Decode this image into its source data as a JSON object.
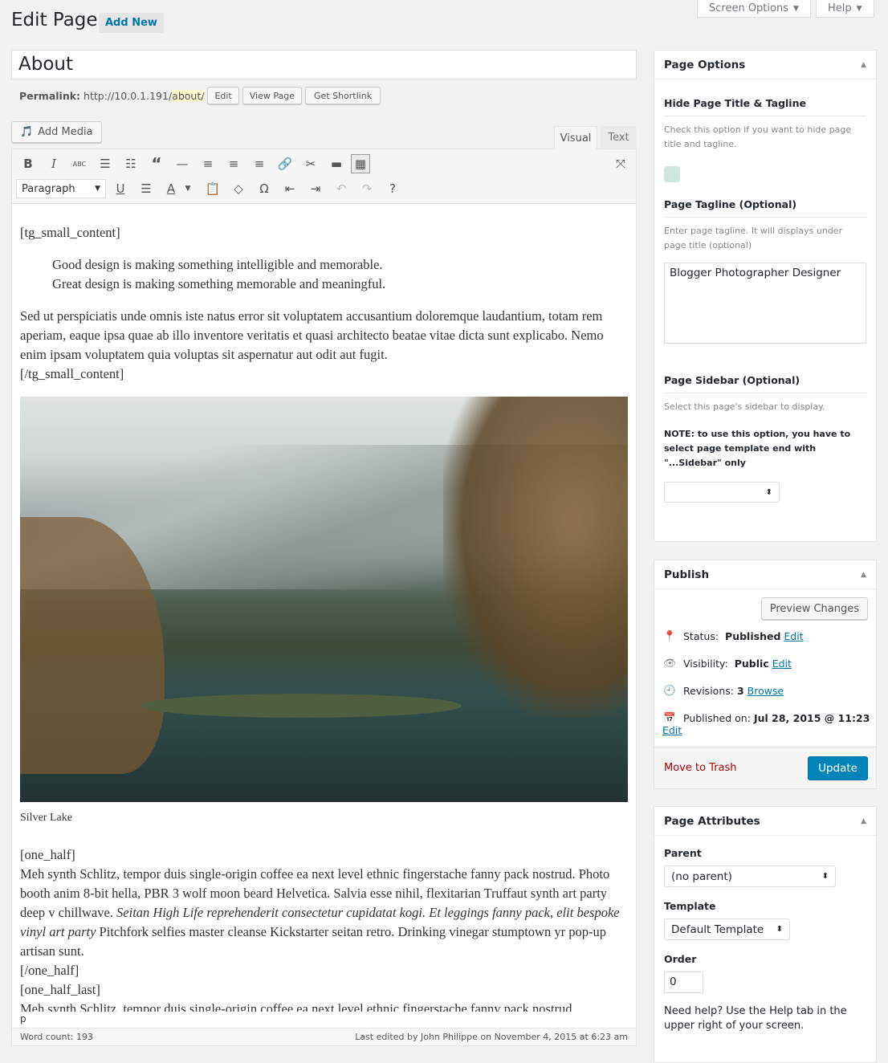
{
  "header": {
    "title": "Edit Page",
    "add_new": "Add New",
    "screen_options": "Screen Options",
    "help": "Help"
  },
  "post": {
    "title": "About",
    "permalink_label": "Permalink:",
    "permalink_base": "http://10.0.1.191/",
    "permalink_slug": "about/",
    "edit": "Edit",
    "view_page": "View Page",
    "get_shortlink": "Get Shortlink"
  },
  "editor": {
    "add_media": "Add Media",
    "tab_visual": "Visual",
    "tab_text": "Text",
    "format_select": "Paragraph",
    "toolbar_row1": [
      "bold-icon",
      "italic-icon",
      "strikethrough-icon",
      "bullet-list-icon",
      "numbered-list-icon",
      "blockquote-icon",
      "horizontal-line-icon",
      "align-left-icon",
      "align-center-icon",
      "align-right-icon",
      "link-icon",
      "unlink-icon",
      "read-more-icon",
      "toolbar-toggle-icon"
    ],
    "toolbar_row2": [
      "underline-icon",
      "justify-icon",
      "text-color-icon",
      "paste-text-icon",
      "clear-format-icon",
      "special-char-icon",
      "outdent-icon",
      "indent-icon",
      "undo-icon",
      "redo-icon",
      "help-icon"
    ],
    "content": {
      "open_tag": "[tg_small_content]",
      "quote1": "Good design is making something intelligible and memorable.",
      "quote2": "Great design is making something memorable and meaningful.",
      "para1": "Sed ut perspiciatis unde omnis iste natus error sit voluptatem accusantium doloremque laudantium, totam rem aperiam, eaque ipsa quae ab illo inventore veritatis et quasi architecto beatae vitae dicta sunt explicabo. Nemo enim ipsam voluptatem quia voluptas sit aspernatur aut odit aut fugit.",
      "close_tag": "[/tg_small_content]",
      "caption": "Silver Lake",
      "half_open": "[one_half]",
      "half_text_a": "Meh synth Schlitz, tempor duis single-origin coffee ea next level ethnic fingerstache fanny pack nostrud. Photo booth anim 8-bit hella, PBR 3 wolf moon beard Helvetica. Salvia esse nihil, flexitarian Truffaut synth art party deep v chillwave. ",
      "half_text_italic": "Seitan High Life reprehenderit consectetur cupidatat kogi. Et leggings fanny pack, elit bespoke vinyl art party",
      "half_text_b": " Pitchfork selfies master cleanse Kickstarter seitan retro. Drinking vinegar stumptown yr pop-up artisan sunt.",
      "half_close": "[/one_half]",
      "half_last_open": "[one_half_last]",
      "half_last_text": "Meh synth Schlitz, tempor duis single-origin coffee ea next level ethnic fingerstache fanny pack nostrud."
    },
    "path": "p",
    "word_count": "Word count: 193",
    "last_edited": "Last edited by John Philippe on November 4, 2015 at 6:23 am"
  },
  "page_options": {
    "title": "Page Options",
    "hide_title": "Hide Page Title & Tagline",
    "hide_desc": "Check this option if you want to hide page title and tagline.",
    "tagline_title": "Page Tagline (Optional)",
    "tagline_desc": "Enter page tagline. It will displays under page title (optional)",
    "tagline_value": "Blogger Photographer Designer",
    "sidebar_title": "Page Sidebar (Optional)",
    "sidebar_desc": "Select this page's sidebar to display.",
    "sidebar_note": "NOTE: to use this option, you have to select page template end with \"...Sidebar\" only",
    "sidebar_value": ""
  },
  "publish": {
    "title": "Publish",
    "preview": "Preview Changes",
    "status_label": "Status:",
    "status_value": "Published",
    "visibility_label": "Visibility:",
    "visibility_value": "Public",
    "revisions_label": "Revisions:",
    "revisions_value": "3",
    "browse": "Browse",
    "published_label": "Published on:",
    "published_value": "Jul 28, 2015 @ 11:23",
    "edit": "Edit",
    "trash": "Move to Trash",
    "update": "Update",
    "accent": "#0085ba"
  },
  "attributes": {
    "title": "Page Attributes",
    "parent_label": "Parent",
    "parent_value": "(no parent)",
    "template_label": "Template",
    "template_value": "Default Template",
    "order_label": "Order",
    "order_value": "0",
    "help": "Need help? Use the Help tab in the upper right of your screen."
  }
}
